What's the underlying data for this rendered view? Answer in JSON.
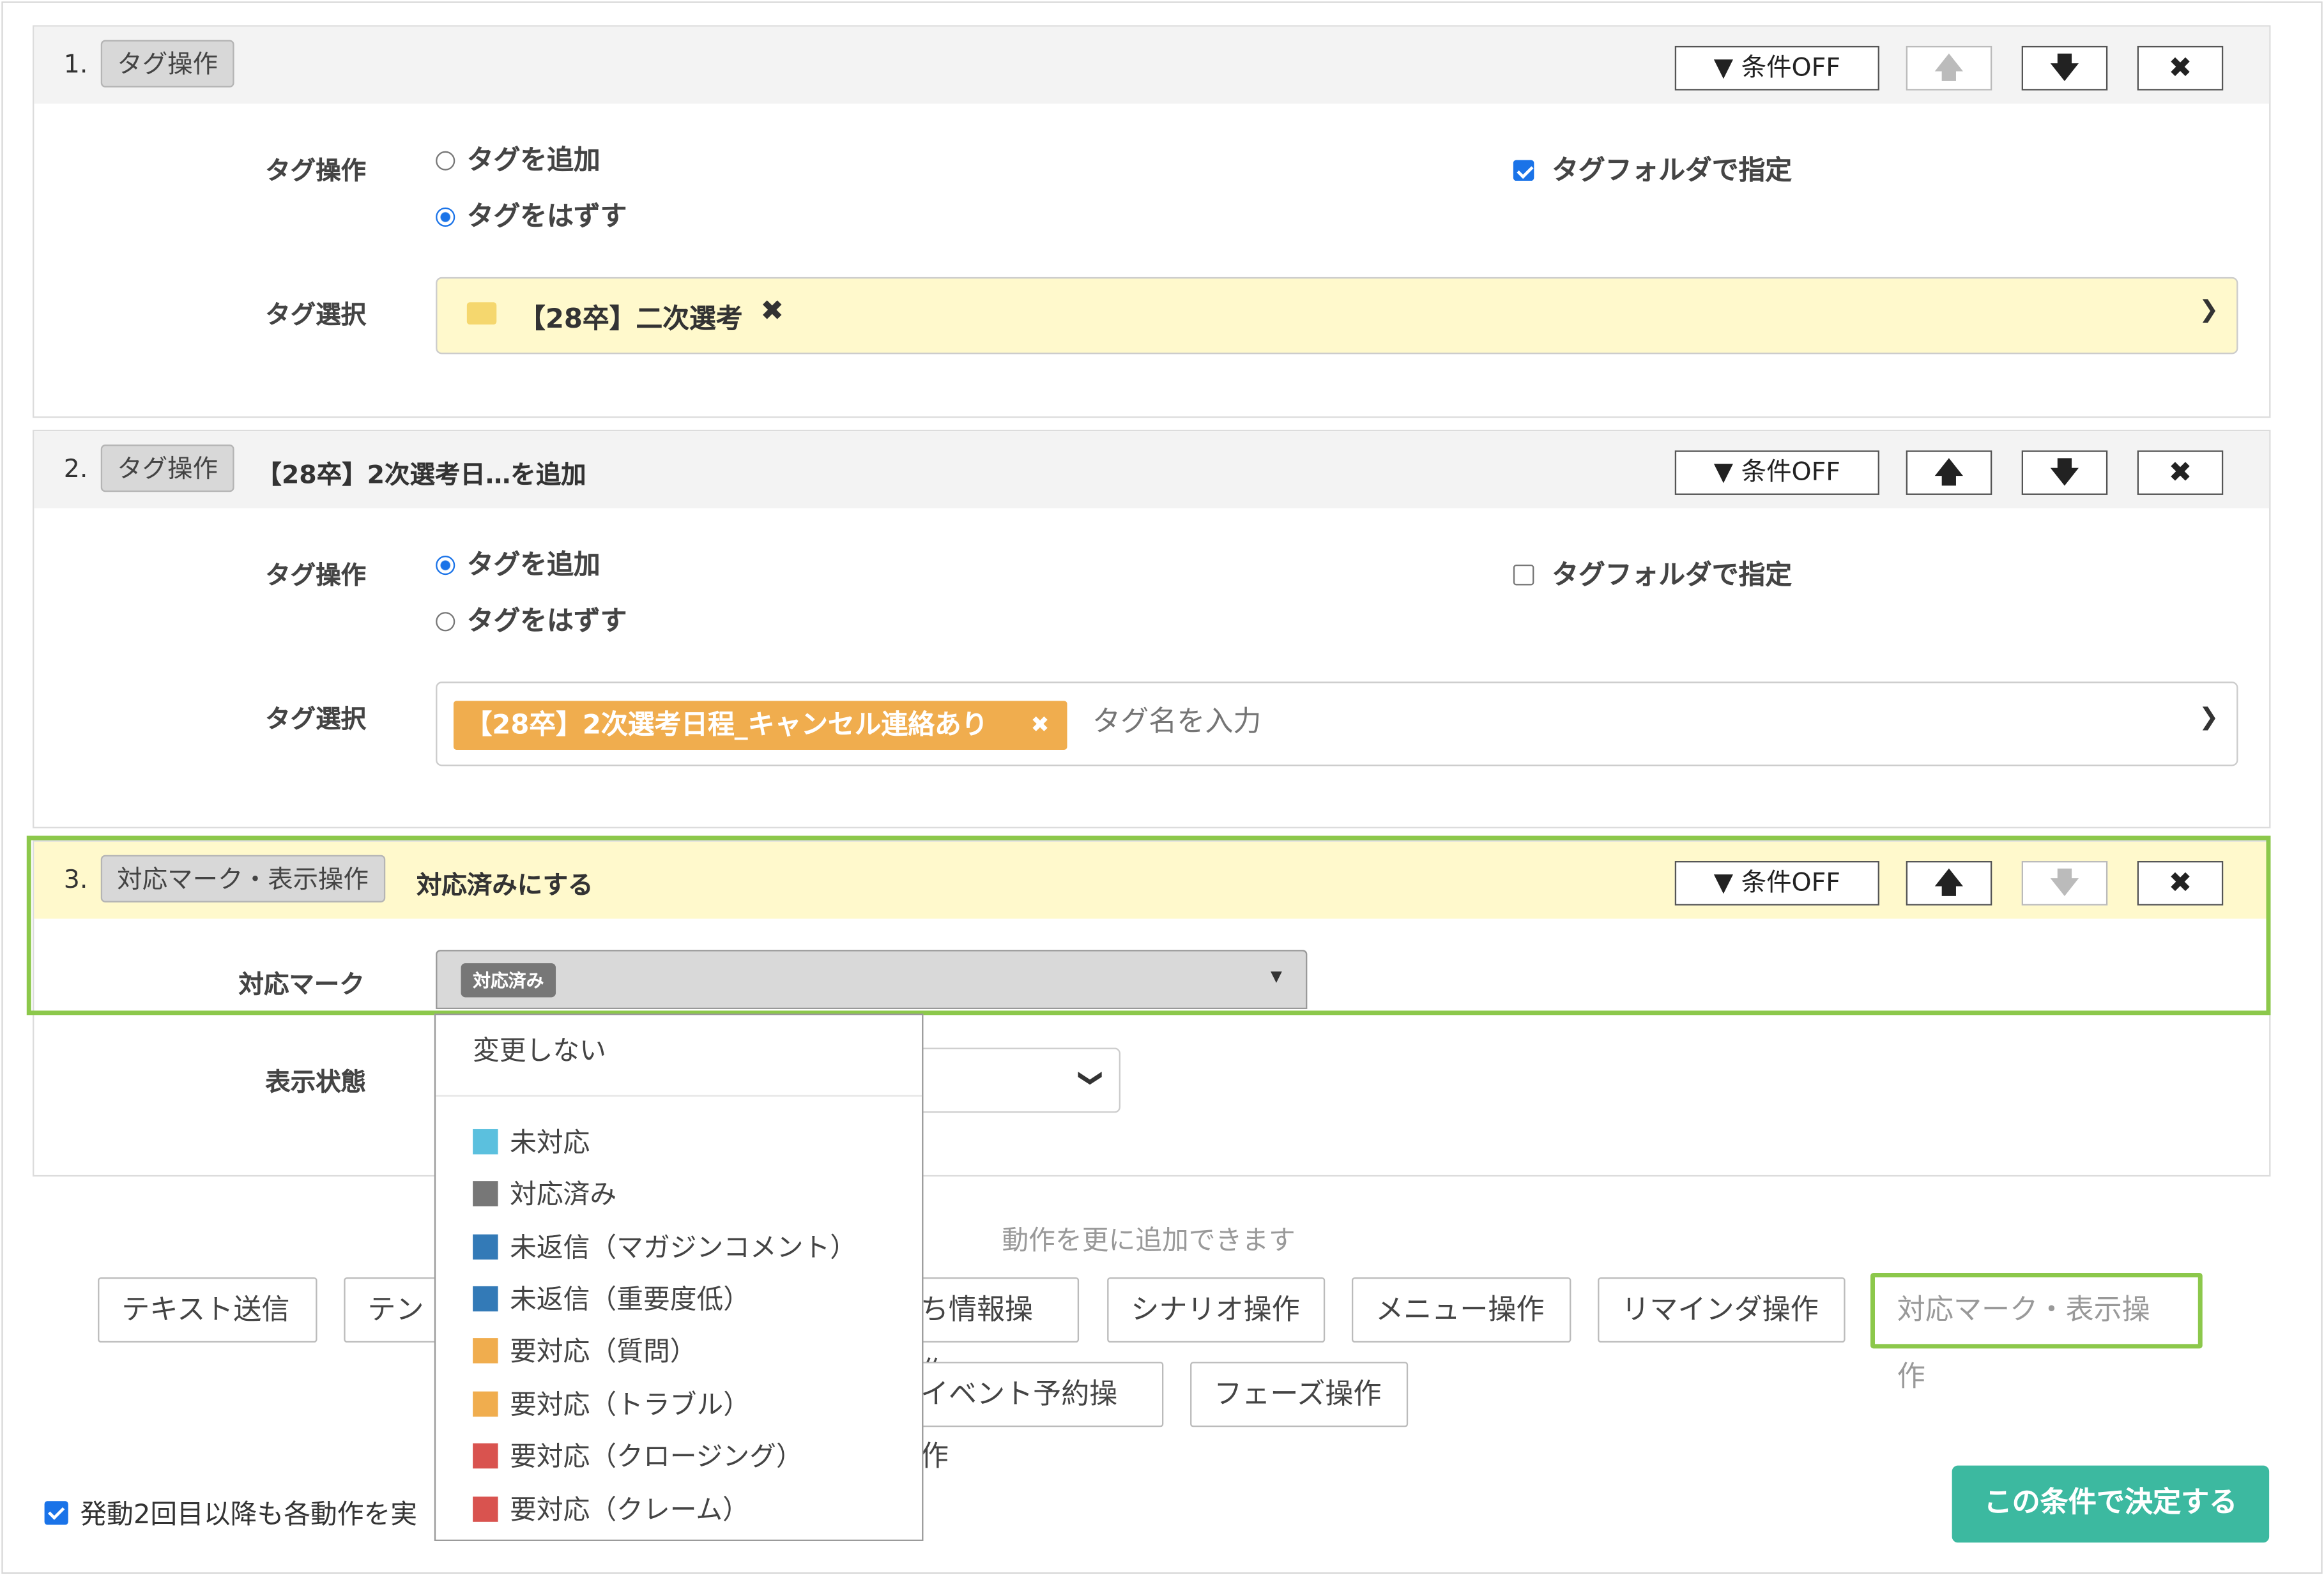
{
  "header_buttons": {
    "condition_off": "条件OFF"
  },
  "actions": [
    {
      "number": "1.",
      "type_chip": "タグ操作",
      "title": "",
      "tag_op_label": "タグ操作",
      "add_option": "タグを追加",
      "remove_option": "タグをはずす",
      "selected": "remove",
      "folder_check_label": "タグフォルダで指定",
      "folder_checked": true,
      "tag_select_label": "タグ選択",
      "selected_folder": "【28卒】二次選考"
    },
    {
      "number": "2.",
      "type_chip": "タグ操作",
      "title": "【28卒】2次選考日…を追加",
      "tag_op_label": "タグ操作",
      "add_option": "タグを追加",
      "remove_option": "タグをはずす",
      "selected": "add",
      "folder_check_label": "タグフォルダで指定",
      "folder_checked": false,
      "tag_select_label": "タグ選択",
      "selected_tag": "【28卒】2次選考日程_キャンセル連絡あり",
      "tag_placeholder": "タグ名を入力"
    },
    {
      "number": "3.",
      "type_chip": "対応マーク・表示操作",
      "title": "対応済みにする",
      "mark_label": "対応マーク",
      "mark_selected": "対応済み",
      "display_label": "表示状態"
    }
  ],
  "mark_dropdown": {
    "no_change": "変更しない",
    "options": [
      {
        "label": "未対応",
        "color": "#5bc0de"
      },
      {
        "label": "対応済み",
        "color": "#777777"
      },
      {
        "label": "未返信（マガジンコメント）",
        "color": "#337ab7"
      },
      {
        "label": "未返信（重要度低）",
        "color": "#337ab7"
      },
      {
        "label": "要対応（質問）",
        "color": "#f0ad4e"
      },
      {
        "label": "要対応（トラブル）",
        "color": "#f0ad4e"
      },
      {
        "label": "要対応（クロージング）",
        "color": "#d9534f"
      },
      {
        "label": "要対応（クレーム）",
        "color": "#d9534f"
      }
    ]
  },
  "add_hint": "動作を更に追加できます",
  "add_buttons_row1": [
    "テキスト送信",
    "テン",
    "ち情報操作",
    "シナリオ操作",
    "メニュー操作",
    "リマインダ操作",
    "対応マーク・表示操作"
  ],
  "add_buttons_row2": [
    "イベント予約操作",
    "フェーズ操作"
  ],
  "footer": {
    "repeat_check_label": "発動2回目以降も各動作を実",
    "repeat_checked": true,
    "submit_label": "この条件で決定する"
  },
  "colors": {
    "highlight": "#8cc84b",
    "submit": "#3cb9a0",
    "tag_chip": "#f0ad4e",
    "yellow_bg": "#fff9cc"
  }
}
